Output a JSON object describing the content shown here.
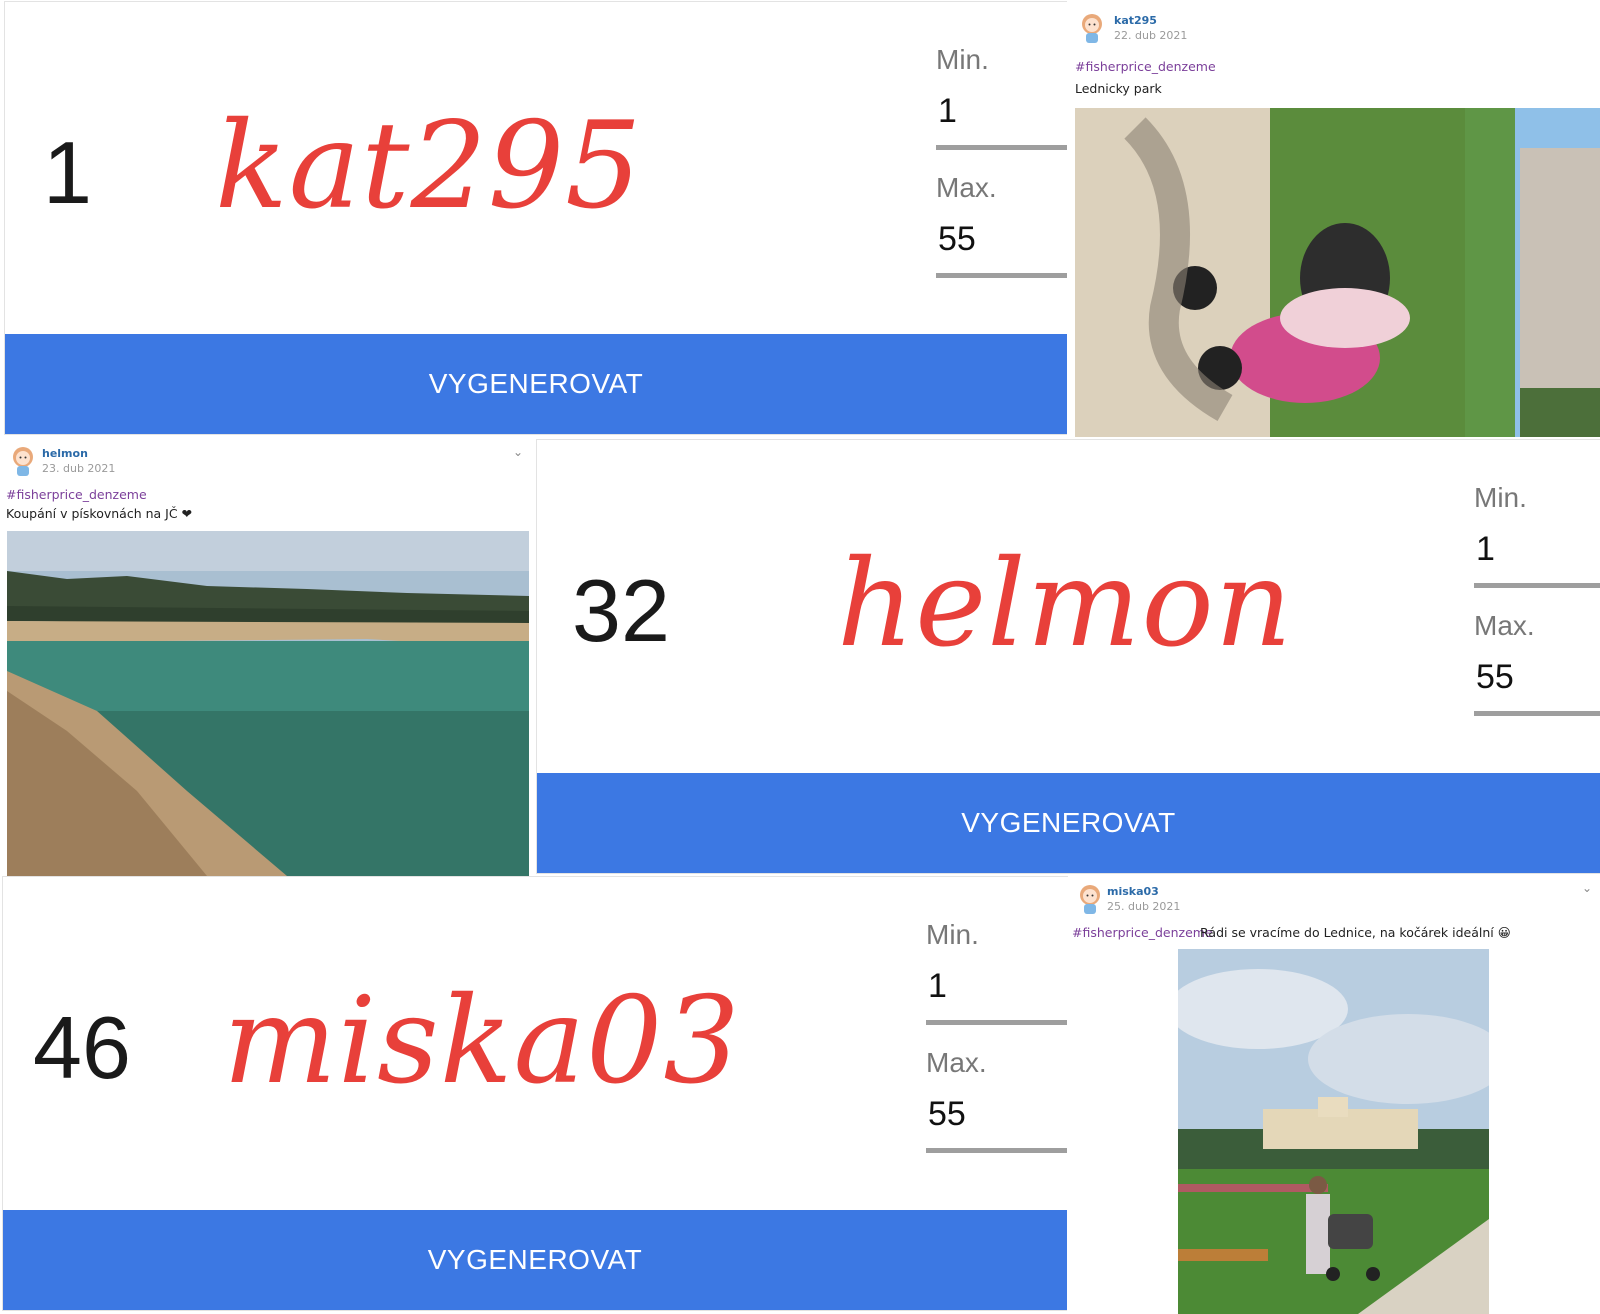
{
  "panels": [
    {
      "number": "1",
      "name": "kat295",
      "min_label": "Min.",
      "min_value": "1",
      "max_label": "Max.",
      "max_value": "55",
      "button": "VYGENEROVAT"
    },
    {
      "number": "32",
      "name": "helmon",
      "min_label": "Min.",
      "min_value": "1",
      "max_label": "Max.",
      "max_value": "55",
      "button": "VYGENEROVAT"
    },
    {
      "number": "46",
      "name": "miska03",
      "min_label": "Min.",
      "min_value": "1",
      "max_label": "Max.",
      "max_value": "55",
      "button": "VYGENEROVAT"
    }
  ],
  "posts": [
    {
      "user": "kat295",
      "date": "22. dub 2021",
      "tag": "#fisherprice_denzeme",
      "text": "Lednicky park"
    },
    {
      "user": "helmon",
      "date": "23. dub 2021",
      "tag": "#fisherprice_denzeme",
      "text": "Koupání v pískovnách na JČ ❤"
    },
    {
      "user": "miska03",
      "date": "25. dub 2021",
      "tag": "#fisherprice_denzeme",
      "text": "Rádi se vracíme do Lednice, na kočárek ideální 😀"
    }
  ],
  "colors": {
    "accent_button": "#3c78e3",
    "name_red": "#e8403a"
  },
  "icons": [
    "avatar-icon",
    "chevron-down-icon"
  ]
}
